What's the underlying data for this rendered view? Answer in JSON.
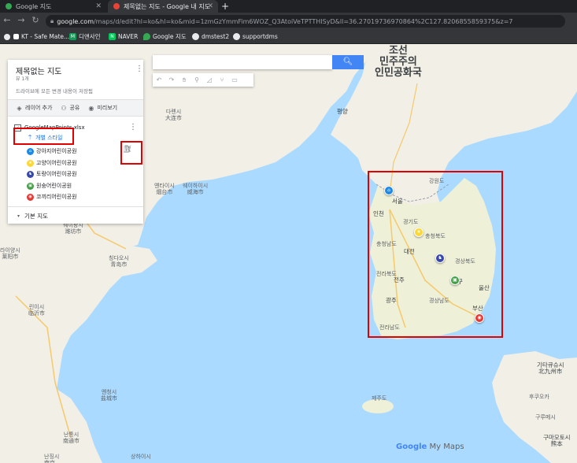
{
  "browser": {
    "tabs": [
      {
        "title": "Google 지도",
        "icon_color": "#34a853",
        "active": false
      },
      {
        "title": "제목없는 지도 - Google 내 지도",
        "icon_color": "#ea4335",
        "active": true
      }
    ],
    "url_host": "google.com",
    "url_path": "/maps/d/edit?hl=ko&hl=ko&mid=1zmGzYmmFim6WOZ_Q3AtoiVeTPTTHISyD&ll=36.27019736970864%2C127.8206855859375&z=7",
    "bookmarks": [
      {
        "label": "KT - Safe Mate...",
        "icon": "square",
        "color": "#ffffff"
      },
      {
        "label": "디앤사인",
        "icon": "M",
        "color": "#0f9d58"
      },
      {
        "label": "NAVER",
        "icon": "N",
        "color": "#03c75a"
      },
      {
        "label": "Google 지도",
        "icon": "pin",
        "color": "#34a853"
      },
      {
        "label": "dmstest2",
        "icon": "globe",
        "color": "#e8eaed"
      },
      {
        "label": "supportdms",
        "icon": "globe",
        "color": "#e8eaed"
      }
    ]
  },
  "panel": {
    "title": "제목없는 지도",
    "subtitle": "뷰 1개",
    "save_notice": "드라이브에 모든 변경 내용이 저장됨",
    "actions": [
      {
        "label": "레이어 추가",
        "icon": "layers-icon"
      },
      {
        "label": "공유",
        "icon": "add-person-icon"
      },
      {
        "label": "미리보기",
        "icon": "eye-icon"
      }
    ],
    "layer_name": "GoogleMapPoints.xlsx",
    "style_link": "개별 스타일",
    "places": [
      {
        "label": "강아지어린이공원",
        "color": "#1e88e5",
        "icon": "home"
      },
      {
        "label": "고양이어린이공원",
        "color": "#fdd835",
        "icon": "star"
      },
      {
        "label": "토랑이어린이공원",
        "color": "#3949ab",
        "icon": "walk"
      },
      {
        "label": "원숭어린이공원",
        "color": "#43a047",
        "icon": "cart"
      },
      {
        "label": "코끼리어린이공원",
        "color": "#e53935",
        "icon": "camera"
      }
    ],
    "basemap_label": "기본 지도"
  },
  "map": {
    "labels": {
      "nk": "조선\n민주주의\n인민공화국",
      "dalian": "다롄시\n大连市",
      "yantai": "옌타이시\n烟台市",
      "weihai": "웨이하이시\n威海市",
      "weifang": "웨이팡시\n潍坊市",
      "qingdao": "칭다오시\n青岛市",
      "laiyang": "라이양시\n莱阳市",
      "linyi": "린이시\n临沂市",
      "yancheng": "옌청시\n盐城市",
      "nantong": "난퉁시\n南通市",
      "pyongyang": "평양",
      "seoul": "서울",
      "incheon": "인천",
      "gangwon": "강원도",
      "gyeonggi": "경기도",
      "chungbuk": "충청북도",
      "chungnam": "충청남도",
      "daejeon": "대전",
      "gyeongbuk": "경상북도",
      "daegu": "대구",
      "jeonbuk": "전라북도",
      "jeonju": "전주",
      "gwangju": "광주",
      "jeonnam": "전라남도",
      "gyeongnam": "경상남도",
      "busan": "부산",
      "ulsan": "울산",
      "jeju": "제주도",
      "kitakyushu": "기타큐슈시\n北九州市",
      "fukuoka": "후쿠오카",
      "kurume": "구루메시",
      "kumamoto": "구마모토시\n熊本",
      "shanghai": "난징시\n南京",
      "nanjing": "상하이시"
    },
    "markers": [
      {
        "name": "marker-gangaji",
        "color": "#1e88e5",
        "icon": "⌂"
      },
      {
        "name": "marker-goyangi",
        "color": "#fdd835",
        "icon": "★"
      },
      {
        "name": "marker-torangi",
        "color": "#3949ab",
        "icon": "♞"
      },
      {
        "name": "marker-wonsung",
        "color": "#43a047",
        "icon": "▣"
      },
      {
        "name": "marker-kokkiri",
        "color": "#e53935",
        "icon": "◉"
      }
    ],
    "watermark": "My Maps",
    "watermark_brand": "Google"
  },
  "colors": {
    "sea": "#aadaff",
    "land": "#f1efe6",
    "korea_land": "#eef0d8",
    "highlight": "#e00000",
    "search_button": "#4285f4"
  }
}
